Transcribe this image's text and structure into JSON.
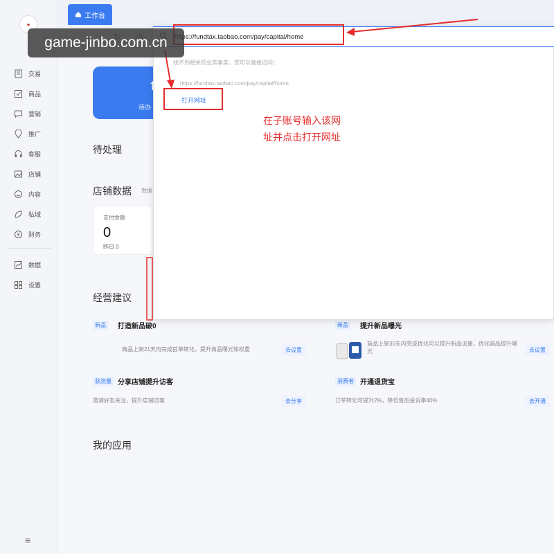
{
  "watermark": "game-jinbo.com.cn",
  "sidebar": {
    "items": [
      {
        "label": "交易",
        "icon": "document-icon"
      },
      {
        "label": "商品",
        "icon": "checkbox-icon"
      },
      {
        "label": "营销",
        "icon": "chat-icon"
      },
      {
        "label": "推广",
        "icon": "location-icon"
      },
      {
        "label": "客服",
        "icon": "headset-icon"
      },
      {
        "label": "店铺",
        "icon": "image-icon"
      },
      {
        "label": "内容",
        "icon": "smile-icon"
      },
      {
        "label": "私域",
        "icon": "leaf-icon"
      },
      {
        "label": "财务",
        "icon": "yuan-icon"
      }
    ],
    "items2": [
      {
        "label": "数据",
        "icon": "chart-icon"
      },
      {
        "label": "设置",
        "icon": "grid-icon"
      }
    ]
  },
  "tabs": {
    "workbench": "工作台"
  },
  "browser": {
    "url": "https://fundtax.taobao.com/pay/capital/home",
    "hint": "找不到相关的业务事务，您可以直接访问：",
    "suggest": "https://fundtax.taobao.com/pay/capital/home",
    "open_link": "打开网址"
  },
  "annotation": {
    "line1": "在子账号输入该网",
    "line2": "址并点击打开网址"
  },
  "main": {
    "card_text": "待办",
    "pending_title": "待处理",
    "store_data_title": "店铺数据",
    "store_data_sub": "数据",
    "stat": {
      "label": "支付金额",
      "value": "0",
      "yesterday": "昨日 0"
    },
    "advice_title": "经营建议",
    "tips": [
      {
        "tag": "新品",
        "title": "打造新品破0",
        "desc": "商品上架21天内完成首单转化，提升商品曝光和权重",
        "btn": "去设置"
      },
      {
        "tag": "新品",
        "title": "提升新品曝光",
        "desc": "商品上架30天内完成优化可以提升新品流量，优化商品提升曝光",
        "btn": "去设置"
      },
      {
        "tag": "获流量",
        "title": "分享店铺提升访客",
        "desc": "邀请好友关注，提升店铺访客",
        "btn": "去分享"
      },
      {
        "tag": "消费者",
        "title": "开通退货宝",
        "desc": "订单转化可提升2%，降低售后投诉率40%",
        "btn": "去开通"
      }
    ],
    "my_apps": "我的应用"
  }
}
